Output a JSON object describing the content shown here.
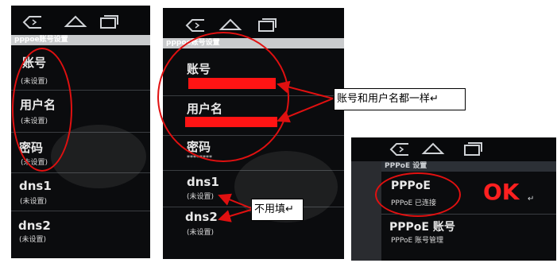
{
  "panel1": {
    "header": "pppoe账号设置",
    "items": [
      {
        "label": "账号",
        "sub": "(未设置)"
      },
      {
        "label": "用户名",
        "sub": "(未设置)"
      },
      {
        "label": "密码",
        "sub": "(未设置)"
      },
      {
        "label": "dns1",
        "sub": "(未设置)"
      },
      {
        "label": "dns2",
        "sub": "(未设置)"
      }
    ]
  },
  "panel2": {
    "header": "pppoe账号设置",
    "items": [
      {
        "label": "账号"
      },
      {
        "label": "用户名"
      },
      {
        "label": "密码",
        "sub": "********"
      },
      {
        "label": "dns1",
        "sub": "(未设置)"
      },
      {
        "label": "dns2",
        "sub": "(未设置)"
      }
    ],
    "callout_same": "账号和用户名都一样↵",
    "callout_skip": "不用填↵"
  },
  "panel3": {
    "header": "PPPoE 设置",
    "items": [
      {
        "label": "PPPoE",
        "sub": "PPPoE 已连接"
      },
      {
        "label": "PPPoE 账号",
        "sub": "PPPoE 账号管理"
      }
    ],
    "ok": "OK",
    "ok_mark": "↵"
  },
  "colors": {
    "annotation_red": "#e01010",
    "redaction": "#ff1414",
    "screen": "#0b0c0e"
  },
  "icons": [
    "back-icon",
    "home-icon",
    "recent-apps-icon"
  ]
}
